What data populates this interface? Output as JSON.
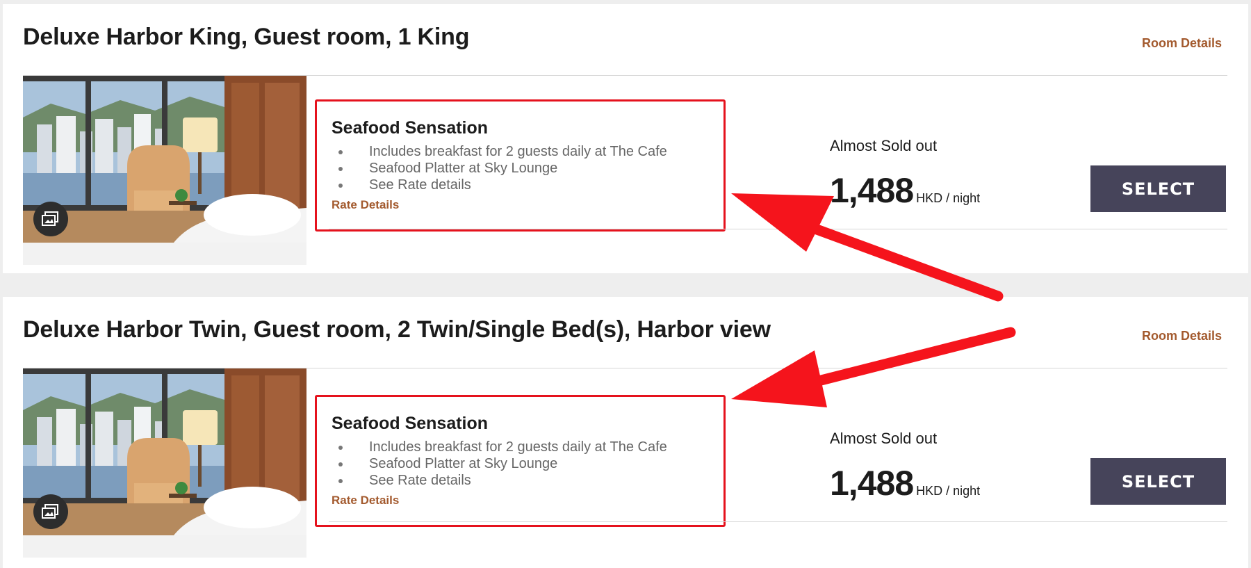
{
  "rooms": [
    {
      "title": "Deluxe Harbor King, Guest room, 1 King",
      "room_details_label": "Room Details",
      "rate": {
        "name": "Seafood Sensation",
        "features": [
          "Includes breakfast for 2 guests daily at The Cafe",
          "Seafood Platter at Sky Lounge",
          "See Rate details"
        ],
        "details_label": "Rate Details"
      },
      "availability": "Almost Sold out",
      "price": "1,488",
      "unit": "HKD / night",
      "select_label": "SELECT"
    },
    {
      "title": "Deluxe Harbor Twin, Guest room, 2 Twin/Single Bed(s), Harbor view",
      "room_details_label": "Room Details",
      "rate": {
        "name": "Seafood Sensation",
        "features": [
          "Includes breakfast for 2 guests daily at The Cafe",
          "Seafood Platter at Sky Lounge",
          "See Rate details"
        ],
        "details_label": "Rate Details"
      },
      "availability": "Almost Sold out",
      "price": "1,488",
      "unit": "HKD / night",
      "select_label": "SELECT"
    }
  ],
  "colors": {
    "link": "#a35a2e",
    "select_button": "#46445a",
    "highlight": "#e5121d"
  },
  "icons": {
    "gallery": "gallery-icon"
  }
}
